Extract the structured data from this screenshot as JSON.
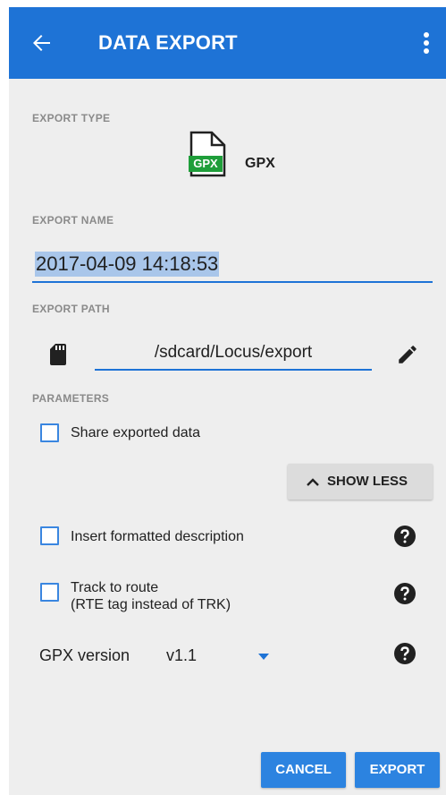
{
  "app_bar": {
    "title": "DATA EXPORT",
    "back_icon": "arrow-back-icon",
    "menu_icon": "more-vert-icon",
    "color": "#1e73d6"
  },
  "export_type": {
    "label": "EXPORT TYPE",
    "file_badge": "GPX",
    "value": "GPX",
    "icon": "gpx-file-icon"
  },
  "export_name": {
    "label": "EXPORT NAME",
    "value": "2017-04-09 14:18:53"
  },
  "export_path": {
    "label": "EXPORT PATH",
    "value": "/sdcard/Locus/export",
    "storage_icon": "sd-card-icon",
    "edit_icon": "pencil-icon"
  },
  "parameters": {
    "label": "PARAMETERS",
    "share": {
      "label": "Share exported data",
      "checked": false
    },
    "show_less_label": "SHOW LESS",
    "insert_description": {
      "label": "Insert formatted description",
      "checked": false
    },
    "track_to_route": {
      "label_line1": "Track to route",
      "label_line2": "(RTE tag instead of TRK)",
      "checked": false
    },
    "gpx_version": {
      "label": "GPX version",
      "value": "v1.1"
    },
    "help_icon": "help-circle-icon"
  },
  "actions": {
    "cancel": "CANCEL",
    "export": "EXPORT"
  },
  "colors": {
    "accent": "#1e73d6",
    "button": "#2c83e0",
    "checkbox_border": "#3a86e0",
    "selection": "#a9c6ea",
    "gpx_badge": "#1f9e3a"
  }
}
